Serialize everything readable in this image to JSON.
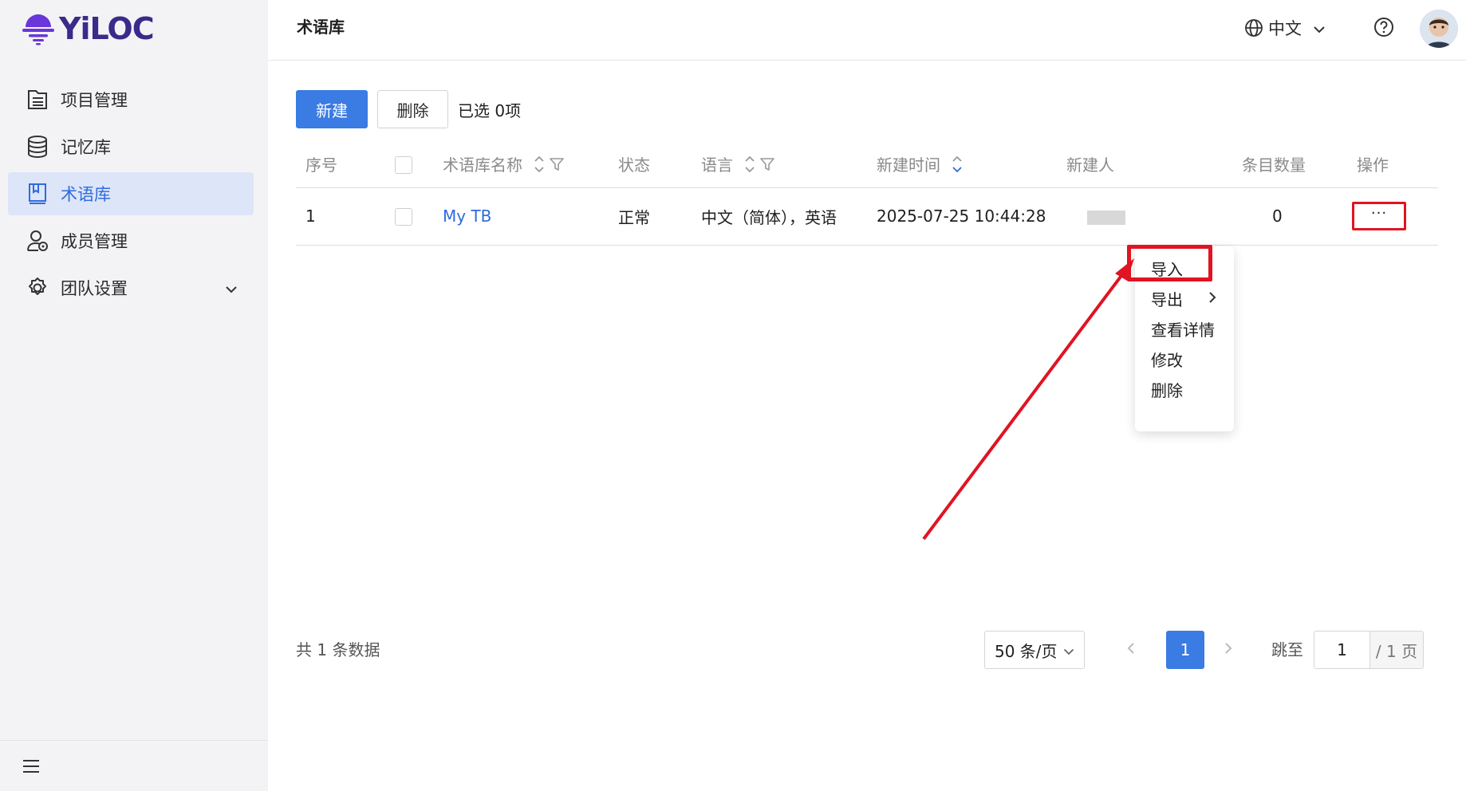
{
  "app": {
    "logo_text": "YiLOC"
  },
  "sidebar": {
    "items": [
      {
        "label": "项目管理",
        "icon": "list-icon"
      },
      {
        "label": "记忆库",
        "icon": "database-icon"
      },
      {
        "label": "术语库",
        "icon": "book-icon",
        "active": true
      },
      {
        "label": "成员管理",
        "icon": "member-icon"
      },
      {
        "label": "团队设置",
        "icon": "gear-icon"
      }
    ]
  },
  "header": {
    "title": "术语库",
    "language": "中文"
  },
  "toolbar": {
    "new_label": "新建",
    "delete_label": "删除",
    "selected_text": "已选 0项"
  },
  "table": {
    "columns": [
      "序号",
      "",
      "术语库名称",
      "状态",
      "语言",
      "新建时间",
      "新建人",
      "条目数量",
      "操作"
    ],
    "rows": [
      {
        "index": "1",
        "name": "My TB",
        "status": "正常",
        "languages": "中文（简体），英语",
        "created_at": "2025-07-25 10:44:28",
        "creator": "",
        "entry_count": "0",
        "action": "···"
      }
    ]
  },
  "dropdown": {
    "items": [
      "导入",
      "导出",
      "查看详情",
      "修改",
      "删除"
    ]
  },
  "pagination": {
    "total_text": "共 1 条数据",
    "page_size": "50 条/页",
    "current_page": "1",
    "jump_label": "跳至",
    "jump_value": "1",
    "jump_suffix": "/ 1 页"
  },
  "colors": {
    "primary": "#3a7be4",
    "annotation_red": "#e01422",
    "sidebar_bg": "#f3f3f5",
    "active_bg": "#dde5f8"
  }
}
